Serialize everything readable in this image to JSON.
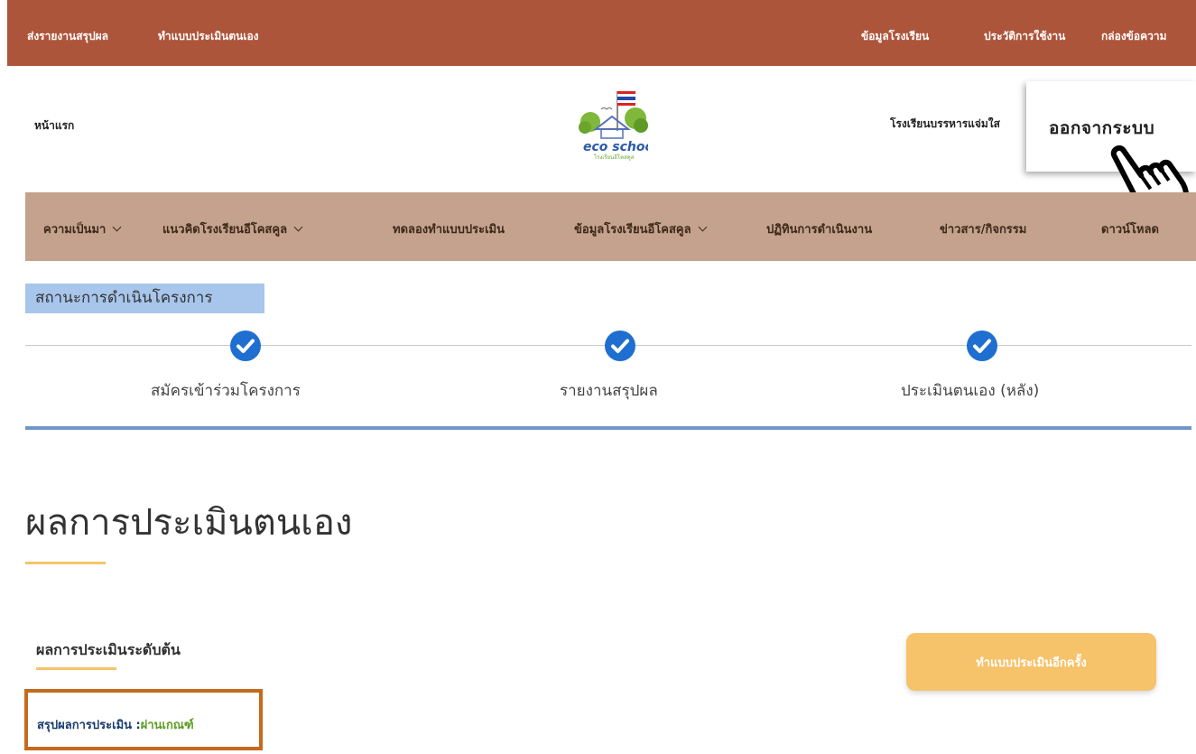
{
  "top_bar": {
    "left_links": [
      "ส่งรายงานสรุปผล",
      "ทำแบบประเมินตนเอง"
    ],
    "right_links": [
      "ข้อมูลโรงเรียน",
      "ประวัติการใช้งาน",
      "กล่องข้อความ"
    ]
  },
  "header": {
    "home_label": "หน้าแรก",
    "logo_text": "eco school",
    "logo_subtext": "โรงเรียนอีโคสคูล",
    "school_name": "โรงเรียนบรรหารแจ่มใส"
  },
  "logout_popup": {
    "label": "ออกจากระบบ"
  },
  "nav": {
    "items": [
      {
        "label": "ความเป็นมา"
      },
      {
        "label": "แนวคิดโรงเรียนอีโคสคูล"
      },
      {
        "label": "ทดลองทำแบบประเมิน"
      },
      {
        "label": "ข้อมูลโรงเรียนอีโคสคูล"
      },
      {
        "label": "ปฏิทินการดำเนินงาน"
      },
      {
        "label": "ข่าวสาร/กิจกรรม"
      },
      {
        "label": "ดาวน์โหลด"
      }
    ]
  },
  "status": {
    "title": "สถานะการดำเนินโครงการ",
    "steps": [
      {
        "label": "สมัครเข้าร่วมโครงการ"
      },
      {
        "label": "รายงานสรุปผล"
      },
      {
        "label": "ประเมินตนเอง (หลัง)"
      }
    ]
  },
  "main": {
    "heading": "ผลการประเมินตนเอง",
    "section_heading": "ผลการประเมินระดับต้น",
    "retake_label": "ทำแบบประเมินอีกครั้ง",
    "summary_label": "สรุปผลการประเมิน :",
    "summary_value": "ผ่านเกณฑ์"
  },
  "colors": {
    "top_bar": "#ad553a",
    "nav_bar": "#c4a28e",
    "accent_blue": "#1f6fd0",
    "accent_yellow": "#f6c26a",
    "pass_green": "#5b9e1e",
    "highlight_border": "#c56a1c"
  }
}
